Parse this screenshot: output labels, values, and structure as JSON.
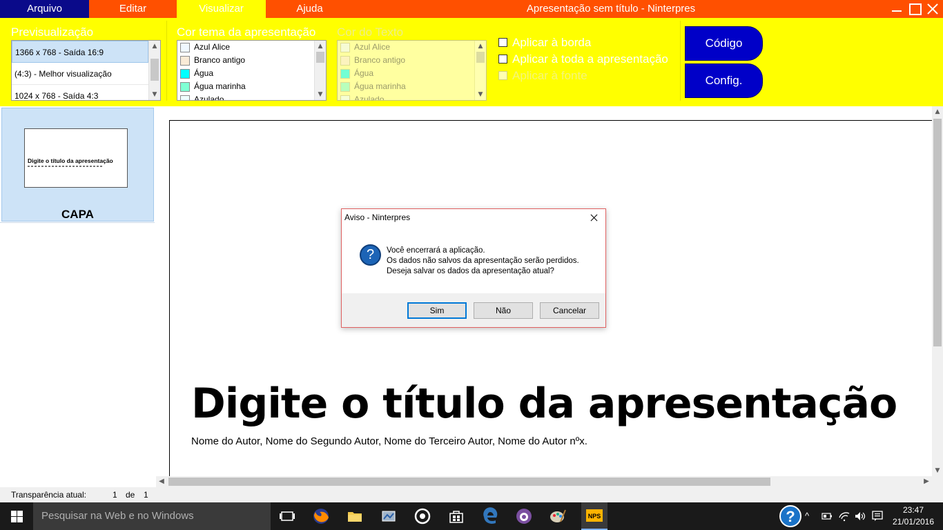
{
  "menu": {
    "tabs": [
      {
        "label": "Arquivo"
      },
      {
        "label": "Editar"
      },
      {
        "label": "Visualizar"
      },
      {
        "label": "Ajuda"
      }
    ],
    "window_title": "Apresentação sem título - Ninterpres"
  },
  "ribbon": {
    "preview_label": "Previsualização",
    "resolutions": [
      {
        "label": "1366 x 768 - Saída 16:9"
      },
      {
        "label": "(4:3) - Melhor visualização"
      },
      {
        "label": "1024 x 768 - Saída 4:3"
      }
    ],
    "theme_color_label": "Cor tema da apresentação",
    "theme_colors": [
      {
        "label": "Azul Alice",
        "color": "#f0f8ff"
      },
      {
        "label": "Branco antigo",
        "color": "#faebd7"
      },
      {
        "label": "Água",
        "color": "#00ffff"
      },
      {
        "label": "Água marinha",
        "color": "#7fffd4"
      },
      {
        "label": "Azulado",
        "color": "#f0ffff"
      }
    ],
    "text_color_label": "Cor do Texto",
    "text_colors": [
      {
        "label": "Azul Alice",
        "color": "#f0f8ff"
      },
      {
        "label": "Branco antigo",
        "color": "#faebd7"
      },
      {
        "label": "Água",
        "color": "#00ffff"
      },
      {
        "label": "Água marinha",
        "color": "#7fffd4"
      },
      {
        "label": "Azulado",
        "color": "#f0ffff"
      }
    ],
    "checkboxes": {
      "border": "Aplicar à borda",
      "whole": "Aplicar à toda a apresentação",
      "font": "Aplicar à fonte"
    },
    "code_button": "Código",
    "config_button": "Config."
  },
  "slides_panel": {
    "thumb_title": "Digite o título da apresentação",
    "slide_name": "CAPA"
  },
  "slide": {
    "title": "Digite o título da apresentação",
    "authors": "Nome do Autor, Nome do Segundo Autor, Nome do Terceiro Autor, Nome do Autor nºx."
  },
  "status": {
    "label": "Transparência atual:",
    "current": "1",
    "of": "de",
    "total": "1"
  },
  "dialog": {
    "title": "Aviso - Ninterpres",
    "icon": "question-icon",
    "line1": "Você encerrará a aplicação.",
    "line2": "Os dados não salvos da apresentação serão perdidos.",
    "line3": "Deseja salvar os dados da apresentação atual?",
    "yes": "Sim",
    "no": "Não",
    "cancel": "Cancelar"
  },
  "taskbar": {
    "search_placeholder": "Pesquisar na Web e no Windows",
    "time": "23:47",
    "date": "21/01/2016"
  },
  "colors": {
    "menubar": "#ff5000",
    "first_tab": "#0a0a8a",
    "ribbon": "#ffff00",
    "buttons": "#0000c8"
  }
}
